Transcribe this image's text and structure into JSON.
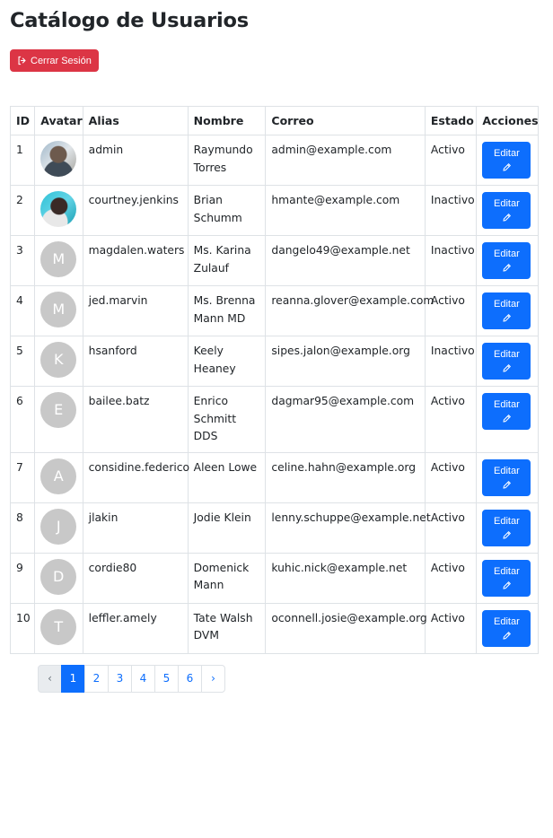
{
  "page": {
    "title": "Catálogo de Usuarios"
  },
  "logout": {
    "label": "Cerrar Sesión",
    "icon": "sign-out-icon",
    "color": "#dc3545"
  },
  "table": {
    "headers": [
      "ID",
      "Avatar",
      "Alias",
      "Nombre",
      "Correo",
      "Estado",
      "Acciones"
    ],
    "edit_label": "Editar",
    "edit_icon": "pencil-icon",
    "accent": "#0d6efd",
    "rows": [
      {
        "id": "1",
        "avatar": "photo",
        "alias": "admin",
        "name": "Raymundo Torres",
        "email": "admin@example.com",
        "status": "Activo"
      },
      {
        "id": "2",
        "avatar": "photo",
        "alias": "courtney.jenkins",
        "name": "Brian Schumm",
        "email": "hmante@example.com",
        "status": "Inactivo"
      },
      {
        "id": "3",
        "avatar": "M",
        "alias": "magdalen.waters",
        "name": "Ms. Karina Zulauf",
        "email": "dangelo49@example.net",
        "status": "Inactivo"
      },
      {
        "id": "4",
        "avatar": "M",
        "alias": "jed.marvin",
        "name": "Ms. Brenna Mann MD",
        "email": "reanna.glover@example.com",
        "status": "Activo"
      },
      {
        "id": "5",
        "avatar": "K",
        "alias": "hsanford",
        "name": "Keely Heaney",
        "email": "sipes.jalon@example.org",
        "status": "Inactivo"
      },
      {
        "id": "6",
        "avatar": "E",
        "alias": "bailee.batz",
        "name": "Enrico Schmitt DDS",
        "email": "dagmar95@example.com",
        "status": "Activo"
      },
      {
        "id": "7",
        "avatar": "A",
        "alias": "considine.federico",
        "name": "Aleen Lowe",
        "email": "celine.hahn@example.org",
        "status": "Activo"
      },
      {
        "id": "8",
        "avatar": "J",
        "alias": "jlakin",
        "name": "Jodie Klein",
        "email": "lenny.schuppe@example.net",
        "status": "Activo"
      },
      {
        "id": "9",
        "avatar": "D",
        "alias": "cordie80",
        "name": "Domenick Mann",
        "email": "kuhic.nick@example.net",
        "status": "Activo"
      },
      {
        "id": "10",
        "avatar": "T",
        "alias": "leffler.amely",
        "name": "Tate Walsh DVM",
        "email": "oconnell.josie@example.org",
        "status": "Activo"
      }
    ]
  },
  "pagination": {
    "prev": "‹",
    "next": "›",
    "pages": [
      "1",
      "2",
      "3",
      "4",
      "5",
      "6"
    ],
    "current": "1"
  }
}
